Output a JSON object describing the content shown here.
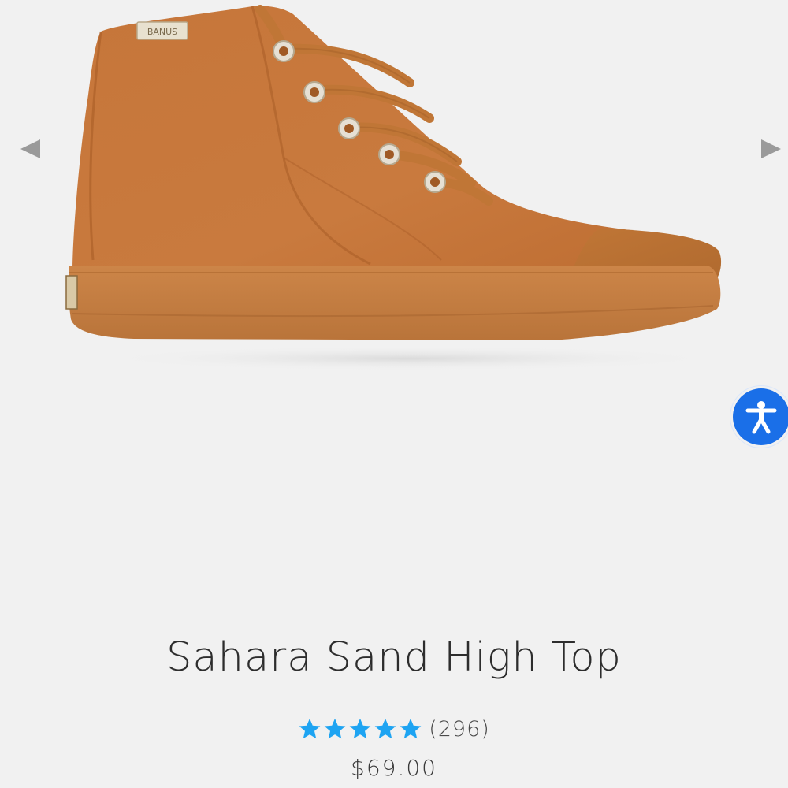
{
  "gallery": {
    "prev_icon": "triangle-left-icon",
    "next_icon": "triangle-right-icon",
    "brand_tag": "BANUS"
  },
  "accessibility": {
    "icon": "accessibility-person-icon",
    "color": "#1a6fe8"
  },
  "product": {
    "title": "Sahara Sand High Top",
    "rating": {
      "stars": 5,
      "max": 5,
      "count_label": "(296)",
      "star_color": "#1ea4f2"
    },
    "price": "$69.00"
  },
  "colors": {
    "background": "#f1f1f1",
    "canvas": "#c8773b",
    "sole": "#c47d40"
  }
}
